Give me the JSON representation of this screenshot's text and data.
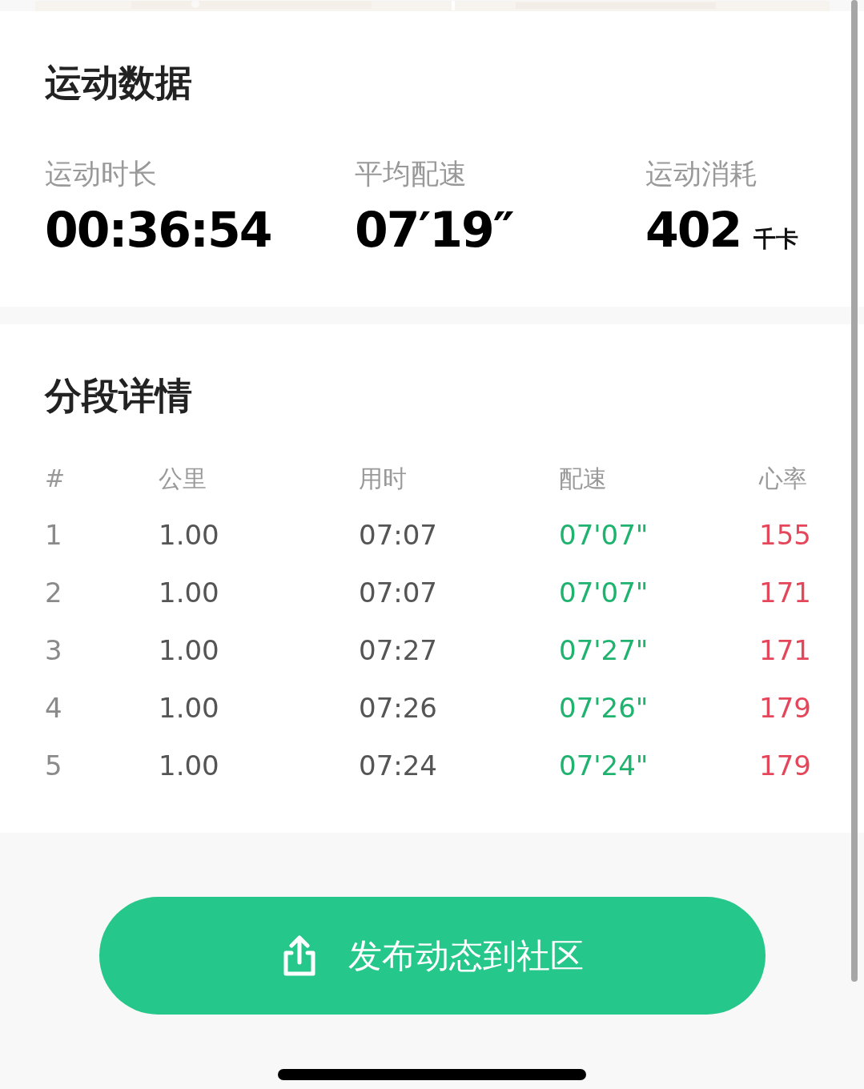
{
  "summary": {
    "title": "运动数据",
    "stats": [
      {
        "label": "运动时长",
        "value": "00:36:54"
      },
      {
        "label": "平均配速",
        "value": "07′19″"
      },
      {
        "label": "运动消耗",
        "value": "402",
        "unit": "千卡"
      }
    ]
  },
  "splits": {
    "title": "分段详情",
    "columns": [
      "#",
      "公里",
      "用时",
      "配速",
      "心率"
    ],
    "rows": [
      [
        "1",
        "1.00",
        "07:07",
        "07'07\"",
        "155"
      ],
      [
        "2",
        "1.00",
        "07:07",
        "07'07\"",
        "171"
      ],
      [
        "3",
        "1.00",
        "07:27",
        "07'27\"",
        "171"
      ],
      [
        "4",
        "1.00",
        "07:26",
        "07'26\"",
        "179"
      ],
      [
        "5",
        "1.00",
        "07:24",
        "07'24\"",
        "179"
      ]
    ]
  },
  "share_button": {
    "label": "发布动态到社区"
  }
}
